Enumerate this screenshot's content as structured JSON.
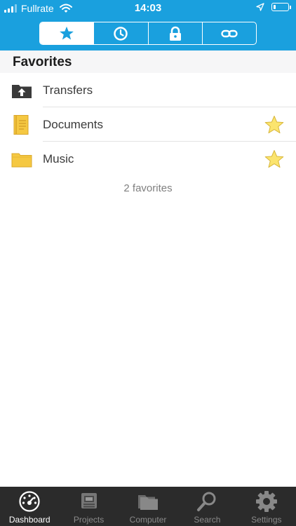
{
  "status_bar": {
    "carrier": "Fullrate",
    "time": "14:03",
    "signal_bars_filled": 3,
    "signal_bars_total": 4,
    "battery_level": 0.15
  },
  "segmented_control": {
    "segments": [
      {
        "icon": "star-icon",
        "active": true
      },
      {
        "icon": "clock-icon",
        "active": false
      },
      {
        "icon": "lock-icon",
        "active": false
      },
      {
        "icon": "link-icon",
        "active": false
      }
    ]
  },
  "section": {
    "title": "Favorites"
  },
  "favorites": {
    "items": [
      {
        "label": "Transfers",
        "icon": "transfers-folder-icon",
        "starred": false
      },
      {
        "label": "Documents",
        "icon": "document-icon",
        "starred": true
      },
      {
        "label": "Music",
        "icon": "folder-icon",
        "starred": true
      }
    ],
    "count_text": "2 favorites"
  },
  "tabbar": {
    "tabs": [
      {
        "label": "Dashboard",
        "icon": "dashboard-icon",
        "active": true
      },
      {
        "label": "Projects",
        "icon": "projects-icon",
        "active": false
      },
      {
        "label": "Computer",
        "icon": "computer-icon",
        "active": false
      },
      {
        "label": "Search",
        "icon": "search-icon",
        "active": false
      },
      {
        "label": "Settings",
        "icon": "settings-gear-icon",
        "active": false
      }
    ]
  },
  "colors": {
    "header_blue": "#1aa0de",
    "section_bg": "#f6f6f7",
    "tabbar_bg": "#2b2b2b",
    "star_yellow": "#fbe46e",
    "folder_yellow": "#f5c842"
  }
}
